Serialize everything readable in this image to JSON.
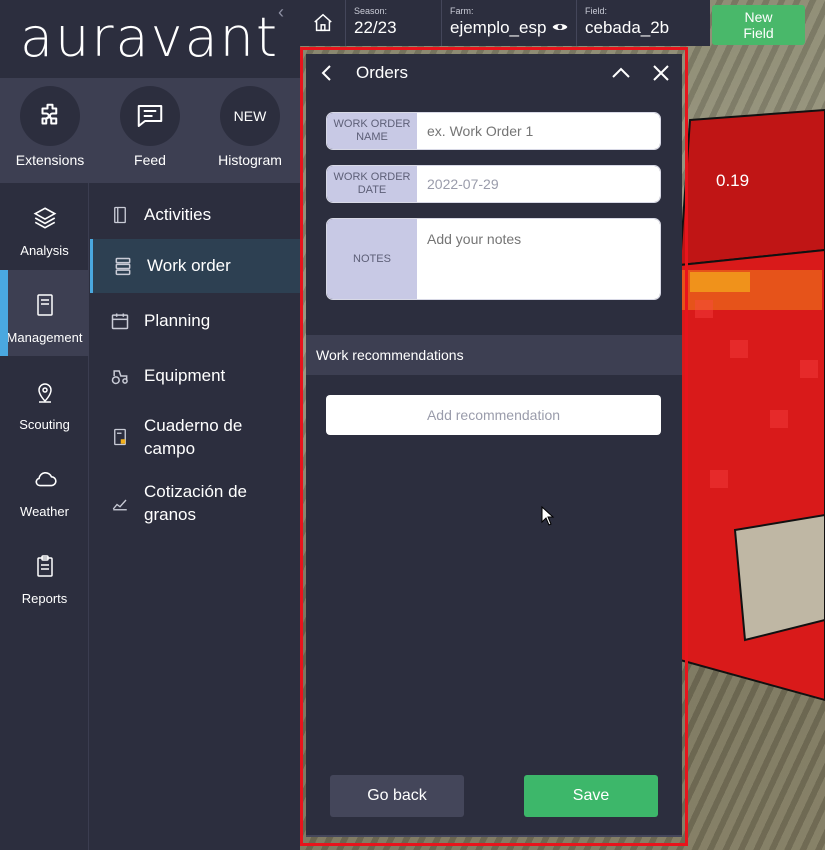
{
  "app": {
    "logo": "auravant"
  },
  "quick_actions": [
    {
      "label": "Extensions",
      "icon": "puzzle-icon"
    },
    {
      "label": "Feed",
      "icon": "chat-icon"
    },
    {
      "label": "Histogram",
      "badge": "NEW"
    }
  ],
  "rail": [
    {
      "label": "Analysis",
      "icon": "layers-icon"
    },
    {
      "label": "Management",
      "icon": "notebook-icon",
      "active": true
    },
    {
      "label": "Scouting",
      "icon": "map-pin-icon"
    },
    {
      "label": "Weather",
      "icon": "cloud-icon"
    },
    {
      "label": "Reports",
      "icon": "clipboard-icon"
    }
  ],
  "submenu": [
    {
      "label": "Activities",
      "icon": "book-icon"
    },
    {
      "label": "Work order",
      "icon": "server-list-icon",
      "active": true
    },
    {
      "label": "Planning",
      "icon": "calendar-icon"
    },
    {
      "label": "Equipment",
      "icon": "tractor-icon"
    },
    {
      "label": "Cuaderno de campo",
      "icon": "field-notebook-icon"
    },
    {
      "label": "Cotización de granos",
      "icon": "chart-trend-icon"
    }
  ],
  "topbar": {
    "season_label": "Season:",
    "season": "22/23",
    "farm_label": "Farm:",
    "farm": "ejemplo_esp",
    "field_label": "Field:",
    "field": "cebada_2b",
    "new_field": "New Field"
  },
  "map": {
    "value_label": "0.19"
  },
  "panel": {
    "title": "Orders",
    "name_label": "WORK ORDER NAME",
    "name_placeholder": "ex. Work Order 1",
    "date_label": "WORK ORDER DATE",
    "date_value": "2022-07-29",
    "notes_label": "NOTES",
    "notes_placeholder": "Add your notes",
    "rec_section": "Work recommendations",
    "add_rec": "Add recommendation",
    "back": "Go back",
    "save": "Save"
  },
  "colors": {
    "accent_blue": "#4aa8e0",
    "save_green": "#3db76a",
    "new_field_green": "#49b86a",
    "highlight_red": "#e8141c"
  }
}
